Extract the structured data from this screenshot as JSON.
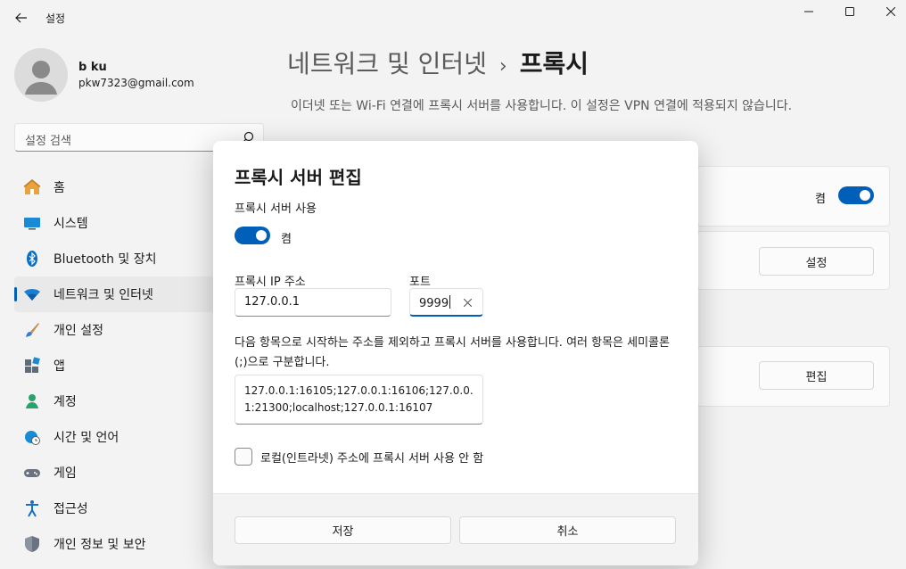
{
  "window": {
    "title": "설정",
    "back_icon": "arrow-left-icon",
    "minimize_icon": "minimize-icon",
    "maximize_icon": "maximize-icon",
    "close_icon": "close-icon"
  },
  "profile": {
    "name": "b ku",
    "email": "pkw7323@gmail.com"
  },
  "search": {
    "placeholder": "설정 검색"
  },
  "sidebar": {
    "items": [
      {
        "label": "홈",
        "icon": "home-icon",
        "active": false
      },
      {
        "label": "시스템",
        "icon": "system-icon",
        "active": false
      },
      {
        "label": "Bluetooth 및 장치",
        "icon": "bluetooth-icon",
        "active": false
      },
      {
        "label": "네트워크 및 인터넷",
        "icon": "wifi-icon",
        "active": true
      },
      {
        "label": "개인 설정",
        "icon": "brush-icon",
        "active": false
      },
      {
        "label": "앱",
        "icon": "apps-icon",
        "active": false
      },
      {
        "label": "계정",
        "icon": "account-icon",
        "active": false
      },
      {
        "label": "시간 및 언어",
        "icon": "clock-globe-icon",
        "active": false
      },
      {
        "label": "게임",
        "icon": "gamepad-icon",
        "active": false
      },
      {
        "label": "접근성",
        "icon": "accessibility-icon",
        "active": false
      },
      {
        "label": "개인 정보 및 보안",
        "icon": "shield-icon",
        "active": false
      }
    ]
  },
  "main": {
    "breadcrumb_parent": "네트워크 및 인터넷",
    "breadcrumb_separator": "›",
    "breadcrumb_current": "프록시",
    "description": "이더넷 또는 Wi-Fi 연결에 프록시 서버를 사용합니다. 이 설정은 VPN 연결에 적용되지 않습니다.",
    "auto_toggle_state": "켬",
    "setup_button": "설정",
    "edit_button": "편집"
  },
  "dialog": {
    "title": "프록시 서버 편집",
    "use_proxy_label": "프록시 서버 사용",
    "toggle_state": "켬",
    "toggle_on": true,
    "ip_label": "프록시 IP 주소",
    "ip_value": "127.0.0.1",
    "port_label": "포트",
    "port_value": "9999",
    "exceptions_description": "다음 항목으로 시작하는 주소를 제외하고 프록시 서버를 사용합니다. 여러 항목은 세미콜론(;)으로 구분합니다.",
    "exceptions_value": "127.0.0.1:16105;127.0.0.1:16106;127.0.0.1:21300;localhost;127.0.0.1:16107",
    "local_checkbox_label": "로컬(인트라넷) 주소에 프록시 서버 사용 안 함",
    "local_checkbox_checked": false,
    "save_button": "저장",
    "cancel_button": "취소"
  },
  "colors": {
    "accent": "#005fb8",
    "background": "#f3f3f3",
    "dialog_bg": "#ffffff"
  }
}
